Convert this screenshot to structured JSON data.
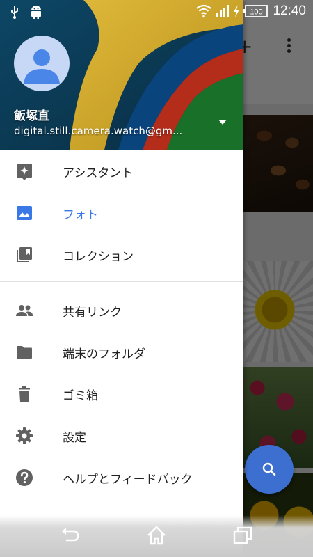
{
  "status_bar": {
    "time": "12:40",
    "battery": "100"
  },
  "drawer": {
    "account": {
      "name": "飯塚直",
      "email": "digital.still.camera.watch@gm..."
    },
    "items": [
      {
        "id": "assistant",
        "label": "アシスタント",
        "icon": "assistant-icon",
        "selected": false
      },
      {
        "id": "photos",
        "label": "フォト",
        "icon": "photo-icon",
        "selected": true
      },
      {
        "id": "collections",
        "label": "コレクション",
        "icon": "collections-icon",
        "selected": false
      },
      {
        "id": "shared-links",
        "label": "共有リンク",
        "icon": "people-icon",
        "selected": false
      },
      {
        "id": "device-folders",
        "label": "端末のフォルダ",
        "icon": "folder-icon",
        "selected": false
      },
      {
        "id": "trash",
        "label": "ゴミ箱",
        "icon": "trash-icon",
        "selected": false
      },
      {
        "id": "settings",
        "label": "設定",
        "icon": "gear-icon",
        "selected": false
      },
      {
        "id": "help",
        "label": "ヘルプとフィードバック",
        "icon": "help-icon",
        "selected": false
      }
    ]
  },
  "colors": {
    "accent": "#3b78e7",
    "fab": "#3c6fd0",
    "icon_gray": "#616161"
  }
}
